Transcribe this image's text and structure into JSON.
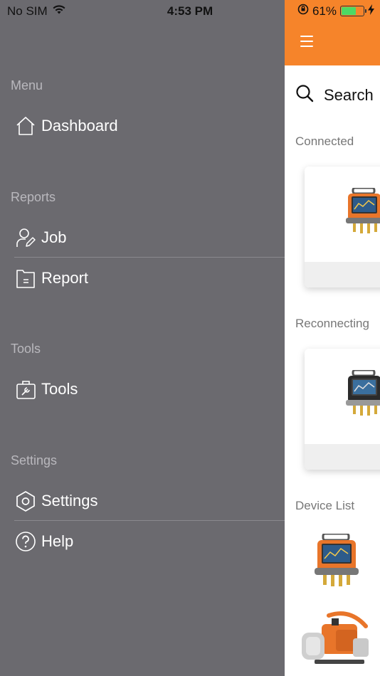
{
  "status_bar": {
    "carrier": "No SIM",
    "time": "4:53 PM",
    "battery": "61%",
    "battery_level": 0.61,
    "battery_color": "#4cd964"
  },
  "menu": {
    "sections": {
      "menu": "Menu",
      "reports": "Reports",
      "tools": "Tools",
      "settings": "Settings"
    },
    "items": {
      "dashboard": "Dashboard",
      "job": "Job",
      "report": "Report",
      "tools": "Tools",
      "settings": "Settings",
      "help": "Help"
    }
  },
  "panel": {
    "header_color": "#f6842a",
    "search_label": "Search",
    "connected_label": "Connected",
    "reconnecting_label": "Reconnecting",
    "device_list_label": "Device List"
  },
  "icons": [
    "wifi-icon",
    "orientation-lock-icon",
    "battery-icon",
    "charging-icon",
    "home-icon",
    "user-edit-icon",
    "document-icon",
    "toolbox-icon",
    "hexagon-settings-icon",
    "help-icon",
    "hamburger-icon",
    "search-icon"
  ]
}
